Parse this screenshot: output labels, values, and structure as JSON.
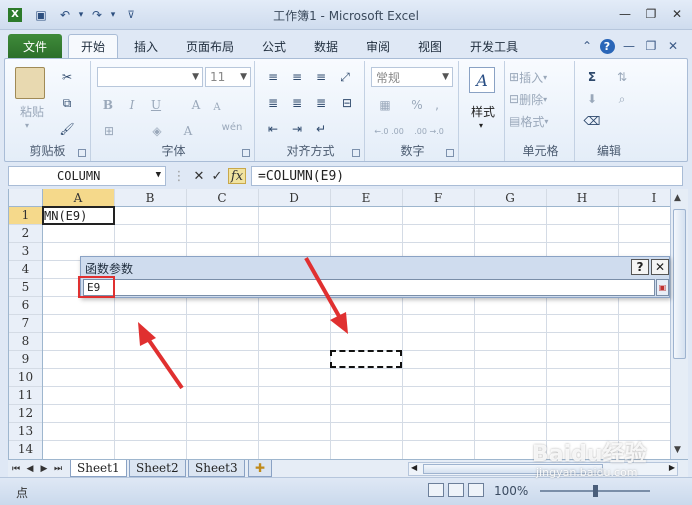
{
  "window": {
    "title": "工作簿1 - Microsoft Excel"
  },
  "tabs": [
    "文件",
    "开始",
    "插入",
    "页面布局",
    "公式",
    "数据",
    "审阅",
    "视图",
    "开发工具"
  ],
  "ribbon": {
    "clipboard": {
      "label": "剪贴板",
      "paste": "粘贴"
    },
    "font": {
      "label": "字体",
      "font_name": "",
      "font_size": "11",
      "bold": "B",
      "italic": "I",
      "underline": "U",
      "grow": "A",
      "shrink": "A",
      "color_a": "A",
      "wen": "wén"
    },
    "alignment": {
      "label": "对齐方式"
    },
    "number": {
      "label": "数字",
      "format": "常规",
      "percent": "%",
      "comma": ",",
      "inc_decimal": "←.0 .00",
      "dec_decimal": ".00 →.0"
    },
    "styles": {
      "label": "样式"
    },
    "cells": {
      "label": "单元格",
      "insert": "插入",
      "delete": "删除",
      "format": "格式"
    },
    "editing": {
      "label": "编辑",
      "sum": "Σ"
    }
  },
  "formula_bar": {
    "name_box": "COLUMN",
    "formula": "=COLUMN(E9)",
    "fx": "fx"
  },
  "grid": {
    "columns": [
      "A",
      "B",
      "C",
      "D",
      "E",
      "F",
      "G",
      "H",
      "I"
    ],
    "rows": [
      "1",
      "2",
      "3",
      "4",
      "5",
      "6",
      "7",
      "8",
      "9",
      "10",
      "11",
      "12",
      "13",
      "14"
    ],
    "cell_a1": "MN(E9)"
  },
  "dialog": {
    "title": "函数参数",
    "help": "?",
    "close": "✕",
    "input_value": "E9"
  },
  "sheets": [
    "Sheet1",
    "Sheet2",
    "Sheet3"
  ],
  "status": {
    "mode": "点",
    "zoom": "100%"
  },
  "watermark": {
    "text": "Baidu经验",
    "url": "jingyan.baidu.com"
  },
  "colors": {
    "file_tab": "#2c6f2a",
    "highlight_box": "#e03030",
    "arrow": "#e03030"
  }
}
